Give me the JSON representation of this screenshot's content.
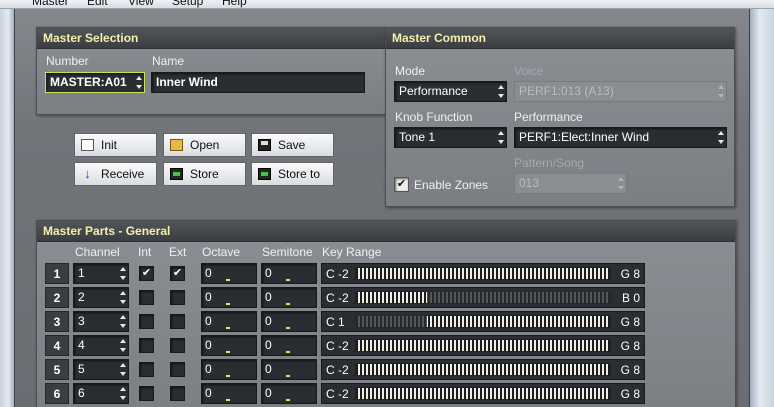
{
  "menu": [
    "Master",
    "Edit",
    "View",
    "Setup",
    "Help"
  ],
  "master_selection": {
    "title": "Master Selection",
    "number_label": "Number",
    "number_value": "MASTER:A01",
    "name_label": "Name",
    "name_value": "Inner Wind"
  },
  "buttons": {
    "init": "Init",
    "open": "Open",
    "save": "Save",
    "receive": "Receive",
    "store": "Store",
    "store_to": "Store to"
  },
  "master_common": {
    "title": "Master Common",
    "mode_label": "Mode",
    "mode_value": "Performance",
    "voice_label": "Voice",
    "voice_value": "PERF1:013 (A13)",
    "knob_label": "Knob Function",
    "knob_value": "Tone 1",
    "performance_label": "Performance",
    "performance_value": "PERF1:Elect:Inner Wind",
    "pattern_label": "Pattern/Song",
    "pattern_value": "013",
    "enable_zones_label": "Enable Zones",
    "enable_zones_checked": true
  },
  "parts": {
    "title": "Master Parts - General",
    "headers": {
      "channel": "Channel",
      "int": "Int",
      "ext": "Ext",
      "octave": "Octave",
      "semitone": "Semitone",
      "key_range": "Key Range"
    },
    "rows": [
      {
        "num": "1",
        "channel": "1",
        "int": true,
        "ext": true,
        "octave": "0",
        "semitone": "0",
        "lo": "C -2",
        "hi": "G 8",
        "lo_frac": 0.0,
        "hi_frac": 1.0
      },
      {
        "num": "2",
        "channel": "2",
        "int": false,
        "ext": false,
        "octave": "0",
        "semitone": "0",
        "lo": "C -2",
        "hi": "B 0",
        "lo_frac": 0.0,
        "hi_frac": 0.28
      },
      {
        "num": "3",
        "channel": "3",
        "int": false,
        "ext": false,
        "octave": "0",
        "semitone": "0",
        "lo": "C 1",
        "hi": "G 8",
        "lo_frac": 0.28,
        "hi_frac": 1.0
      },
      {
        "num": "4",
        "channel": "4",
        "int": false,
        "ext": false,
        "octave": "0",
        "semitone": "0",
        "lo": "C -2",
        "hi": "G 8",
        "lo_frac": 0.0,
        "hi_frac": 1.0
      },
      {
        "num": "5",
        "channel": "5",
        "int": false,
        "ext": false,
        "octave": "0",
        "semitone": "0",
        "lo": "C -2",
        "hi": "G 8",
        "lo_frac": 0.0,
        "hi_frac": 1.0
      },
      {
        "num": "6",
        "channel": "6",
        "int": false,
        "ext": false,
        "octave": "0",
        "semitone": "0",
        "lo": "C -2",
        "hi": "G 8",
        "lo_frac": 0.0,
        "hi_frac": 1.0
      }
    ]
  },
  "colors": {
    "panel_title": "#f4f0a8",
    "octave_tick": "#e7e06a",
    "highlight_border": "#c8e15a"
  }
}
